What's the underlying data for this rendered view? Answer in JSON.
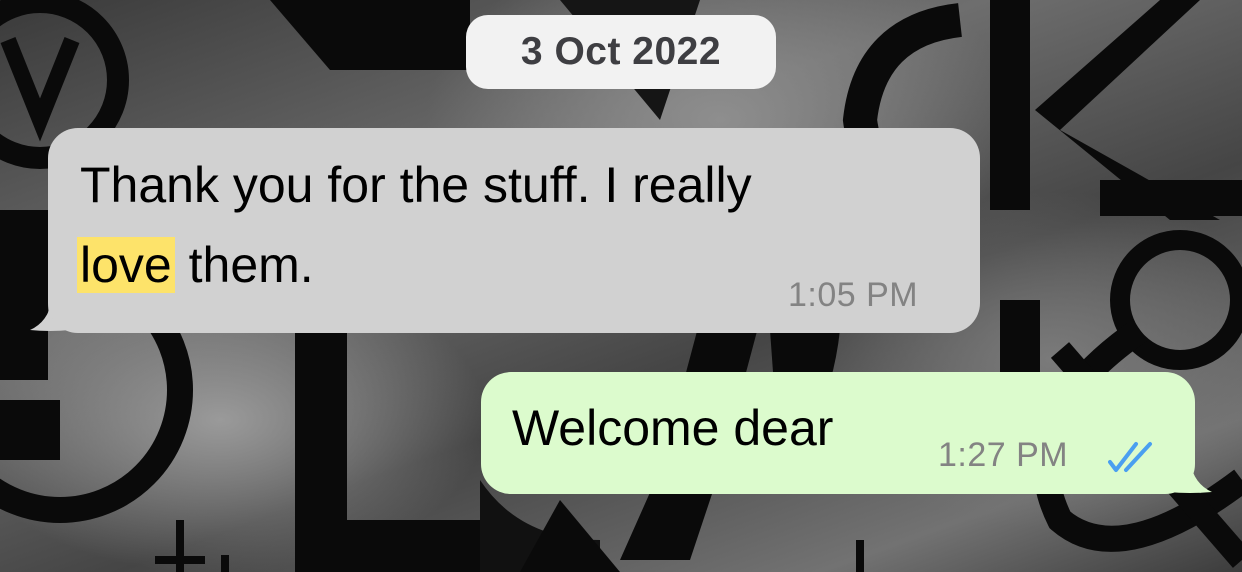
{
  "chat": {
    "date_label": "3 Oct 2022",
    "messages": [
      {
        "direction": "incoming",
        "line1": "Thank you for the stuff. I really",
        "highlighted_word": "love",
        "line2_rest": " them.",
        "time": "1:05 PM",
        "bubble_color": "#d1d1d1",
        "highlight_color": "#fde36a"
      },
      {
        "direction": "outgoing",
        "text": "Welcome dear",
        "time": "1:27 PM",
        "status_icon": "double-check-read-icon",
        "bubble_color": "#dcfbcd",
        "tick_color": "#4a9ff0"
      }
    ]
  },
  "wallpaper": {
    "style": "monochrome ornamental letters"
  }
}
